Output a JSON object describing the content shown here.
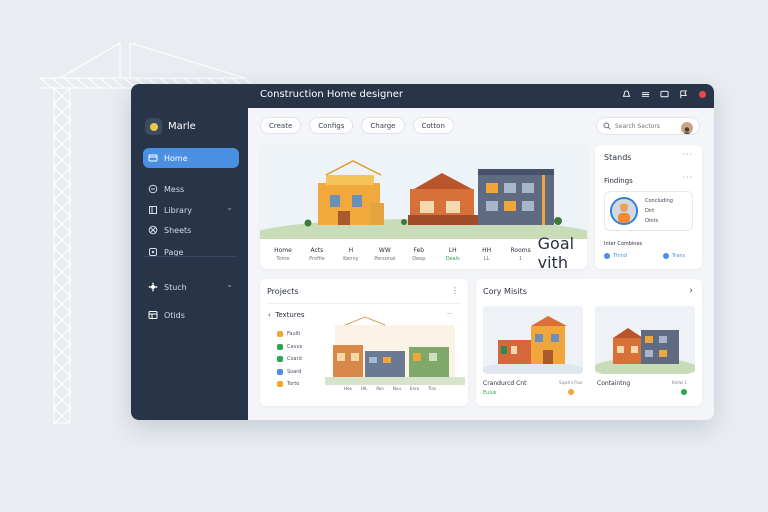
{
  "window": {
    "title": "Construction Home designer"
  },
  "sidebar": {
    "brand": "Marle",
    "items": [
      {
        "label": "Home",
        "icon": "home-icon"
      },
      {
        "label": "Mess",
        "icon": "message-icon"
      },
      {
        "label": "Library",
        "icon": "library-icon"
      },
      {
        "label": "Sheets",
        "icon": "sheets-icon"
      },
      {
        "label": "Page",
        "icon": "page-icon"
      },
      {
        "label": "Stuch",
        "icon": "settings-icon"
      },
      {
        "label": "Otids",
        "icon": "calendar-icon"
      }
    ]
  },
  "toolbar": {
    "chips": [
      "Create",
      "Configs",
      "Charge",
      "Cotton"
    ],
    "search_placeholder": "Search Sectors"
  },
  "hero": {
    "stats": [
      {
        "label": "Home",
        "value": "Tome"
      },
      {
        "label": "Acts",
        "value": "Profile"
      },
      {
        "label": "H",
        "value": "Kenny"
      },
      {
        "label": "WW",
        "value": "Personal"
      },
      {
        "label": "Feb",
        "value": "Deep"
      },
      {
        "label": "LH",
        "value": "Deals"
      },
      {
        "label": "HH",
        "value": "LL"
      },
      {
        "label": "Rooms",
        "value": "1"
      }
    ],
    "last": {
      "label": "Goal vith",
      "value": ""
    }
  },
  "side_panel": {
    "title": "Stands",
    "section": "Findings",
    "profile_lines": [
      "Concluding",
      "Dirt",
      "Oints"
    ],
    "footer": "Inter Combines",
    "links": [
      "Thind",
      "Trans"
    ]
  },
  "projects": {
    "title": "Projects",
    "subtitle": "Textures",
    "items": [
      {
        "label": "Faulti",
        "color": "#f0a630"
      },
      {
        "label": "Cavus",
        "color": "#2ea44f"
      },
      {
        "label": "Coard",
        "color": "#2ea44f"
      },
      {
        "label": "Soard",
        "color": "#4a8fe2"
      },
      {
        "label": "Torto",
        "color": "#f0a630"
      }
    ],
    "scene_labels": [
      "Hoo",
      "HIL",
      "Ron",
      "Nuu",
      "Enro",
      "Tins"
    ]
  },
  "city": {
    "title": "Cory Misits",
    "tiles": [
      {
        "caption": "Crandurcd Cnt",
        "status": "Euius",
        "meta": "Sujarni Flue",
        "dot": "#f0a630"
      },
      {
        "caption": "Containtng",
        "status": "",
        "meta": "Kmlw 1",
        "dot": "#2ea44f"
      }
    ]
  },
  "colors": {
    "accent": "#4a8fe2",
    "sidebar": "#283448",
    "background": "#f3f5f8"
  }
}
